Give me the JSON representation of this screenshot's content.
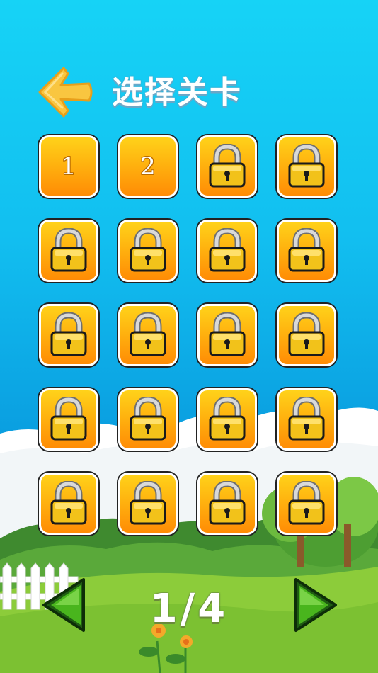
{
  "header": {
    "title": "选择关卡",
    "back_icon": "back-arrow-icon"
  },
  "levels": [
    {
      "label": "1",
      "locked": false
    },
    {
      "label": "2",
      "locked": false
    },
    {
      "label": "",
      "locked": true
    },
    {
      "label": "",
      "locked": true
    },
    {
      "label": "",
      "locked": true
    },
    {
      "label": "",
      "locked": true
    },
    {
      "label": "",
      "locked": true
    },
    {
      "label": "",
      "locked": true
    },
    {
      "label": "",
      "locked": true
    },
    {
      "label": "",
      "locked": true
    },
    {
      "label": "",
      "locked": true
    },
    {
      "label": "",
      "locked": true
    },
    {
      "label": "",
      "locked": true
    },
    {
      "label": "",
      "locked": true
    },
    {
      "label": "",
      "locked": true
    },
    {
      "label": "",
      "locked": true
    },
    {
      "label": "",
      "locked": true
    },
    {
      "label": "",
      "locked": true
    },
    {
      "label": "",
      "locked": true
    },
    {
      "label": "",
      "locked": true
    }
  ],
  "pagination": {
    "current_page": 1,
    "total_pages": 4,
    "label": "1/4",
    "prev_icon": "green-left-triangle-icon",
    "next_icon": "green-right-triangle-icon"
  },
  "colors": {
    "sky_top": "#16d3f6",
    "sky_bottom": "#0b86d3",
    "tile_top": "#ffd21a",
    "tile_bottom": "#ff8c05",
    "grass": "#8ccc3a",
    "arrow": "#f9c640",
    "nav_green": "#49b51d"
  }
}
